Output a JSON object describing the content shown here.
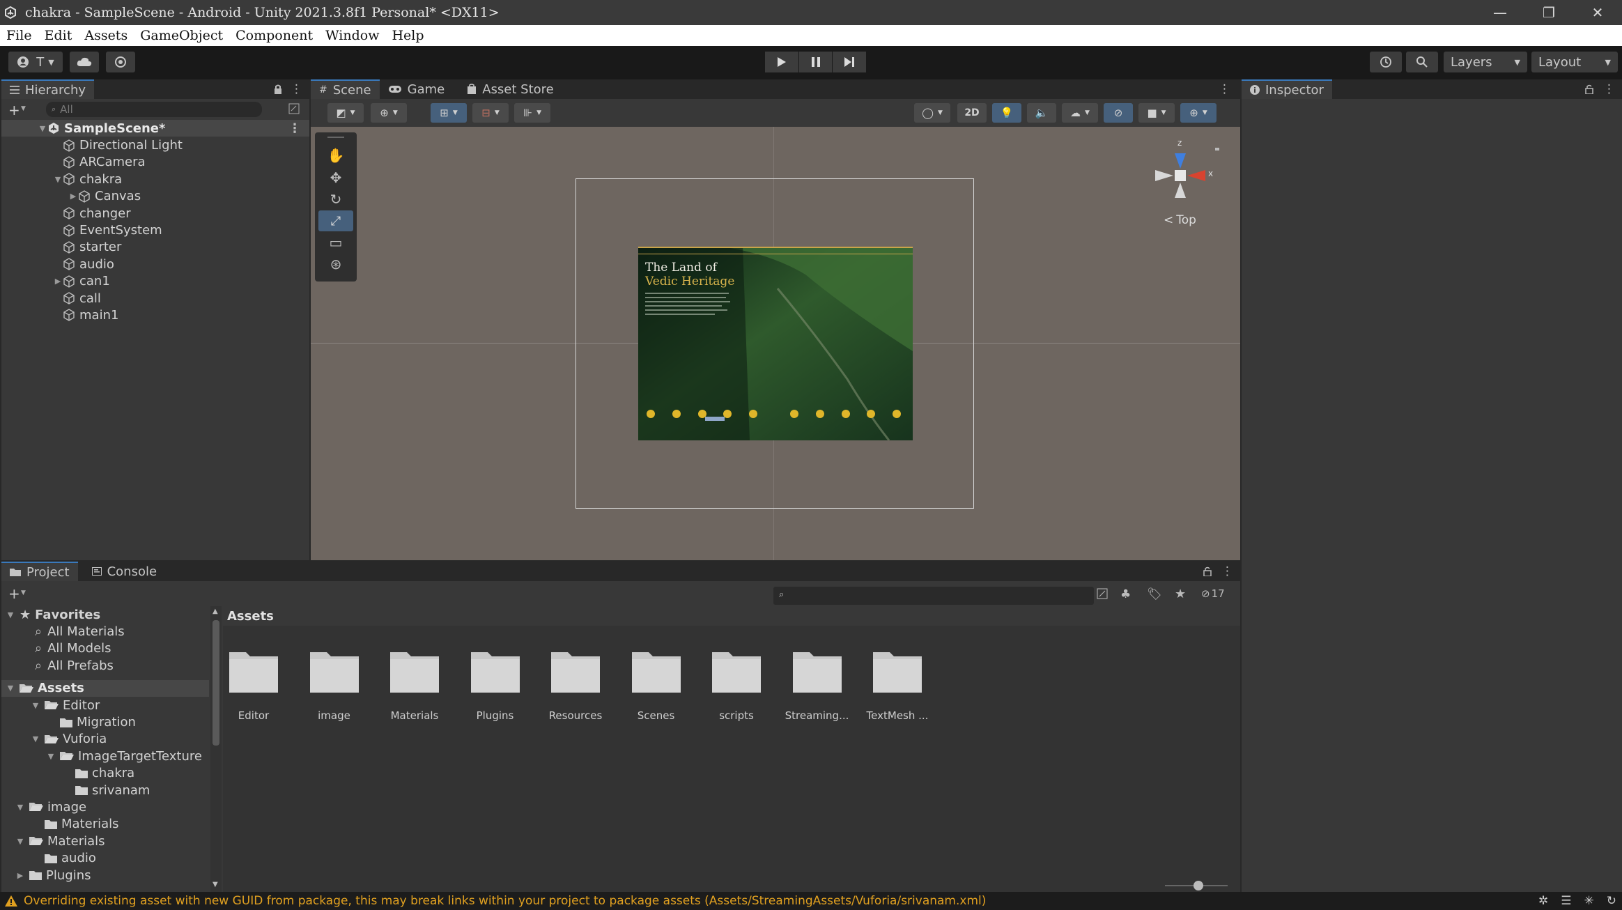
{
  "window": {
    "title": "chakra - SampleScene - Android - Unity 2021.3.8f1 Personal* <DX11>",
    "minimize": "—",
    "restore": "❐",
    "close": "✕"
  },
  "menu": [
    "File",
    "Edit",
    "Assets",
    "GameObject",
    "Component",
    "Window",
    "Help"
  ],
  "toolbar": {
    "account_label": "T",
    "layers_label": "Layers",
    "layout_label": "Layout"
  },
  "hierarchy": {
    "tab": "Hierarchy",
    "search_placeholder": "All",
    "scene": "SampleScene*",
    "items": [
      {
        "label": "Directional Light",
        "depth": 1,
        "expand": ""
      },
      {
        "label": "ARCamera",
        "depth": 1,
        "expand": ""
      },
      {
        "label": "chakra",
        "depth": 1,
        "expand": "▼"
      },
      {
        "label": "Canvas",
        "depth": 2,
        "expand": "▶"
      },
      {
        "label": "changer",
        "depth": 1,
        "expand": ""
      },
      {
        "label": "EventSystem",
        "depth": 1,
        "expand": ""
      },
      {
        "label": "starter",
        "depth": 1,
        "expand": ""
      },
      {
        "label": "audio",
        "depth": 1,
        "expand": ""
      },
      {
        "label": "can1",
        "depth": 1,
        "expand": "▶"
      },
      {
        "label": "call",
        "depth": 1,
        "expand": ""
      },
      {
        "label": "main1",
        "depth": 1,
        "expand": ""
      }
    ]
  },
  "scene": {
    "tabs": [
      "Scene",
      "Game",
      "Asset Store"
    ],
    "mode_2d": "2D",
    "gizmo": {
      "z": "z",
      "x": "x",
      "view": "Top"
    },
    "canvas_image": {
      "title_line1": "The Land of",
      "title_line2": "Vedic Heritage"
    }
  },
  "inspector": {
    "tab": "Inspector"
  },
  "project": {
    "tabs": [
      "Project",
      "Console"
    ],
    "hidden_count": "17",
    "favorites": {
      "label": "Favorites",
      "items": [
        "All Materials",
        "All Models",
        "All Prefabs"
      ]
    },
    "assets_root": "Assets",
    "tree": [
      {
        "label": "Editor",
        "depth": 1,
        "expand": "▼",
        "open": true
      },
      {
        "label": "Migration",
        "depth": 2,
        "expand": "",
        "open": false
      },
      {
        "label": "Vuforia",
        "depth": 1,
        "expand": "▼",
        "open": true
      },
      {
        "label": "ImageTargetTexture",
        "depth": 2,
        "expand": "▼",
        "open": true
      },
      {
        "label": "chakra",
        "depth": 3,
        "expand": "",
        "open": false
      },
      {
        "label": "srivanam",
        "depth": 3,
        "expand": "",
        "open": false
      },
      {
        "label": "image",
        "depth": 0,
        "expand": "▼",
        "open": true
      },
      {
        "label": "Materials",
        "depth": 1,
        "expand": "",
        "open": false
      },
      {
        "label": "Materials",
        "depth": 0,
        "expand": "▼",
        "open": true
      },
      {
        "label": "audio",
        "depth": 1,
        "expand": "",
        "open": false
      },
      {
        "label": "Plugins",
        "depth": 0,
        "expand": "▶",
        "open": false
      }
    ],
    "assets_header": "Assets",
    "folders": [
      "Editor",
      "image",
      "Materials",
      "Plugins",
      "Resources",
      "Scenes",
      "scripts",
      "Streaming...",
      "TextMesh ..."
    ]
  },
  "status": {
    "message": "Overriding existing asset with new GUID from package, this may break links within your project to package assets (Assets/StreamingAssets/Vuforia/srivanam.xml)"
  },
  "colors": {
    "accent": "#3a79bb",
    "selected_tool": "#46607c",
    "warning": "#e0a020",
    "gizmo_x": "#d8432f",
    "gizmo_z": "#3f7fdf",
    "folder": "#c8c8c8"
  }
}
